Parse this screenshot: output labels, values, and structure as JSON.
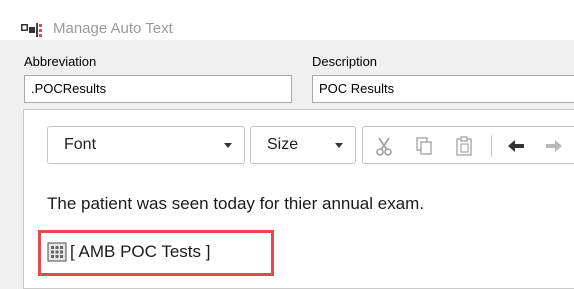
{
  "window": {
    "title": "Manage Auto Text",
    "icon": "auto-text-app-icon"
  },
  "form": {
    "abbreviation_label": "Abbreviation",
    "abbreviation_value": ".POCResults",
    "description_label": "Description",
    "description_value": "POC Results"
  },
  "toolbar": {
    "font_select": "Font",
    "size_select": "Size",
    "icons": [
      "cut-icon",
      "copy-icon",
      "paste-icon",
      "undo-icon",
      "redo-icon"
    ]
  },
  "editor": {
    "body_text": "The patient was seen today for thier annual exam.",
    "auto_text_token": "[ AMB POC Tests ]",
    "highlight_color": "#e8484a"
  }
}
